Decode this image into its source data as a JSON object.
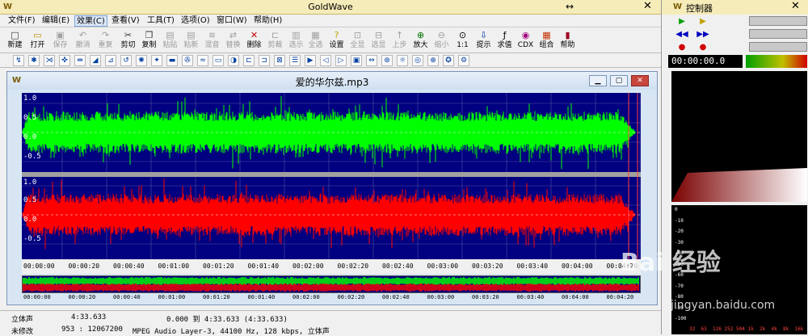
{
  "app": {
    "title": "GoldWave"
  },
  "menu": [
    {
      "label": "文件(F)"
    },
    {
      "label": "编辑(E)"
    },
    {
      "label": "效果(C)"
    },
    {
      "label": "查看(V)"
    },
    {
      "label": "工具(T)"
    },
    {
      "label": "选项(O)"
    },
    {
      "label": "窗口(W)"
    },
    {
      "label": "帮助(H)"
    }
  ],
  "toolbar": [
    {
      "label": "新建",
      "icon": "new-icon",
      "enabled": true
    },
    {
      "label": "打开",
      "icon": "open-icon",
      "enabled": true
    },
    {
      "label": "保存",
      "icon": "save-icon",
      "enabled": false
    },
    {
      "label": "撤消",
      "icon": "undo-icon",
      "enabled": false
    },
    {
      "label": "重复",
      "icon": "redo-icon",
      "enabled": false
    },
    {
      "label": "剪切",
      "icon": "cut-icon",
      "enabled": true
    },
    {
      "label": "复制",
      "icon": "copy-icon",
      "enabled": true
    },
    {
      "label": "粘贴",
      "icon": "paste-icon",
      "enabled": false
    },
    {
      "label": "粘新",
      "icon": "paste-new-icon",
      "enabled": false
    },
    {
      "label": "混音",
      "icon": "mix-icon",
      "enabled": false
    },
    {
      "label": "替换",
      "icon": "replace-icon",
      "enabled": false
    },
    {
      "label": "删除",
      "icon": "delete-icon",
      "enabled": true
    },
    {
      "label": "剪裁",
      "icon": "trim-icon",
      "enabled": false
    },
    {
      "label": "选示",
      "icon": "show-selection-icon",
      "enabled": false
    },
    {
      "label": "全选",
      "icon": "select-all-icon",
      "enabled": false
    },
    {
      "label": "设置",
      "icon": "set-icon",
      "enabled": true
    },
    {
      "label": "全显",
      "icon": "show-all-icon",
      "enabled": false
    },
    {
      "label": "选显",
      "icon": "zoom-selection-icon",
      "enabled": false
    },
    {
      "label": "上步",
      "icon": "previous-icon",
      "enabled": false
    },
    {
      "label": "放大",
      "icon": "zoom-in-icon",
      "enabled": true
    },
    {
      "label": "缩小",
      "icon": "zoom-out-icon",
      "enabled": false
    },
    {
      "label": "1:1",
      "icon": "zoom-1to1-icon",
      "enabled": true
    },
    {
      "label": "提示",
      "icon": "cue-icon",
      "enabled": true
    },
    {
      "label": "求值",
      "icon": "evaluate-icon",
      "enabled": true
    },
    {
      "label": "CDX",
      "icon": "cd-icon",
      "enabled": true
    },
    {
      "label": "组合",
      "icon": "combine-icon",
      "enabled": true
    },
    {
      "label": "帮助",
      "icon": "help-book-icon",
      "enabled": true
    }
  ],
  "effects_bar": [
    "effect-icon"
  ],
  "document": {
    "title": "爱的华尔兹.mp3"
  },
  "wave": {
    "amplitude_labels": [
      "1.0",
      "0.5",
      "0.0",
      "-0.5"
    ],
    "channels": [
      {
        "name": "left",
        "color": "#00ff00"
      },
      {
        "name": "right",
        "color": "#ff0000"
      }
    ],
    "background": "#000080",
    "duration": "4:33.633",
    "timeline": [
      "00:00:00",
      "00:00:20",
      "00:00:40",
      "00:01:00",
      "00:01:20",
      "00:01:40",
      "00:02:00",
      "00:02:20",
      "00:02:40",
      "00:03:00",
      "00:03:20",
      "00:03:40",
      "00:04:00",
      "00:04:20"
    ]
  },
  "overview_timeline": [
    "00:00:00",
    "00:00:20",
    "00:00:40",
    "00:01:00",
    "00:01:20",
    "00:01:40",
    "00:02:00",
    "00:02:20",
    "00:02:40",
    "00:03:00",
    "00:03:20",
    "00:03:40",
    "00:04:00",
    "00:04:20"
  ],
  "status": {
    "channel_mode": "立体声",
    "length": "4:33.633",
    "selection": "0.000 到 4:33.633 (4:33.633)",
    "modified": "未修改",
    "position": "953 : 12067200",
    "format": "MPEG Audio Layer-3, 44100 Hz, 128 kbps, 立体声"
  },
  "controller": {
    "title": "控制器",
    "time": "00:00:00.0",
    "spectrum_scale": [
      "0",
      "-10",
      "-20",
      "-30",
      "-40",
      "-50",
      "-60",
      "-70",
      "-80",
      "-90",
      "-100"
    ],
    "freq_labels": [
      "32",
      "63",
      "126",
      "252",
      "504",
      "1k",
      "2k",
      "4k",
      "8k",
      "16k"
    ]
  },
  "watermark": {
    "text1": "Bai 经验",
    "text2": "jingyan.baidu.com"
  }
}
